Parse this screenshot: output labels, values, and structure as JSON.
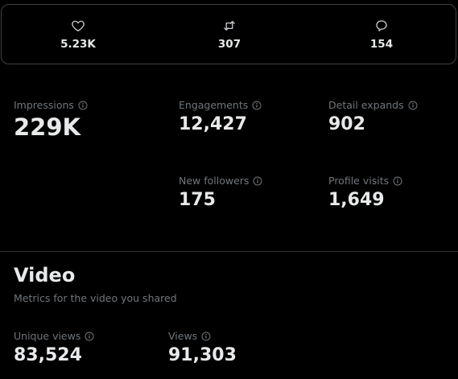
{
  "engagement": {
    "likes": {
      "icon": "heart-icon",
      "value": "5.23K"
    },
    "reposts": {
      "icon": "repost-icon",
      "value": "307"
    },
    "replies": {
      "icon": "reply-icon",
      "value": "154"
    }
  },
  "metrics": {
    "impressions": {
      "label": "Impressions",
      "value": "229K"
    },
    "engagements": {
      "label": "Engagements",
      "value": "12,427"
    },
    "detail_expands": {
      "label": "Detail expands",
      "value": "902"
    },
    "new_followers": {
      "label": "New followers",
      "value": "175"
    },
    "profile_visits": {
      "label": "Profile visits",
      "value": "1,649"
    }
  },
  "video": {
    "title": "Video",
    "subtitle": "Metrics for the video you shared",
    "unique_views": {
      "label": "Unique views",
      "value": "83,524"
    },
    "views": {
      "label": "Views",
      "value": "91,303"
    }
  },
  "colors": {
    "background": "#000000",
    "text_primary": "#e7e9ea",
    "text_secondary": "#71767b",
    "border": "#3e4144"
  }
}
